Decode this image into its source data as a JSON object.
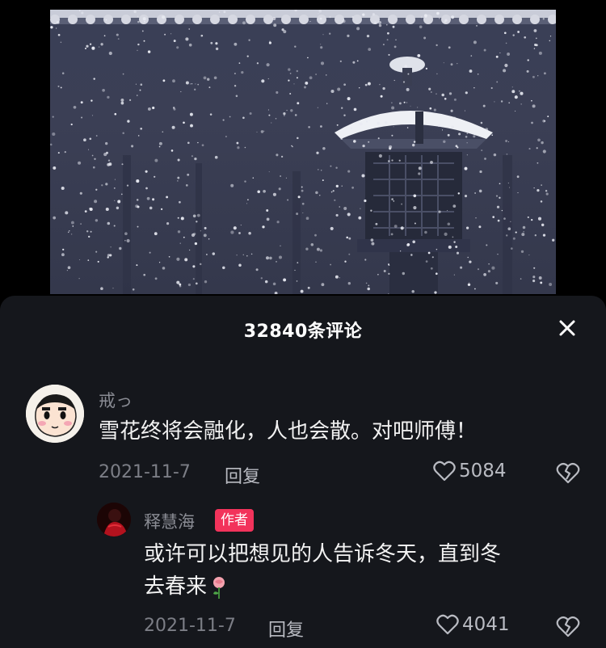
{
  "header": {
    "comment_count_title": "32840条评论",
    "close_icon": "close-icon"
  },
  "comments": [
    {
      "username": "戒っ",
      "text": "雪花终将会融化，人也会散。对吧师傅！",
      "date": "2021-11-7",
      "reply_label": "回复",
      "likes": "5084",
      "like_icon": "heart-outline-icon",
      "dislike_icon": "broken-heart-icon"
    }
  ],
  "replies": [
    {
      "username": "释慧海",
      "badge": "作者",
      "text_line1": "或许可以把想见的人告诉冬天，直到冬",
      "text_line2": "去春来",
      "emoji": "rose-icon",
      "date": "2021-11-7",
      "reply_label": "回复",
      "likes": "4041",
      "like_icon": "heart-outline-icon",
      "dislike_icon": "broken-heart-icon"
    }
  ],
  "colors": {
    "sheet_bg": "#15171c",
    "badge_bg": "#f2335b",
    "text_primary": "#f2f2f2",
    "text_secondary": "#8a8c94"
  }
}
